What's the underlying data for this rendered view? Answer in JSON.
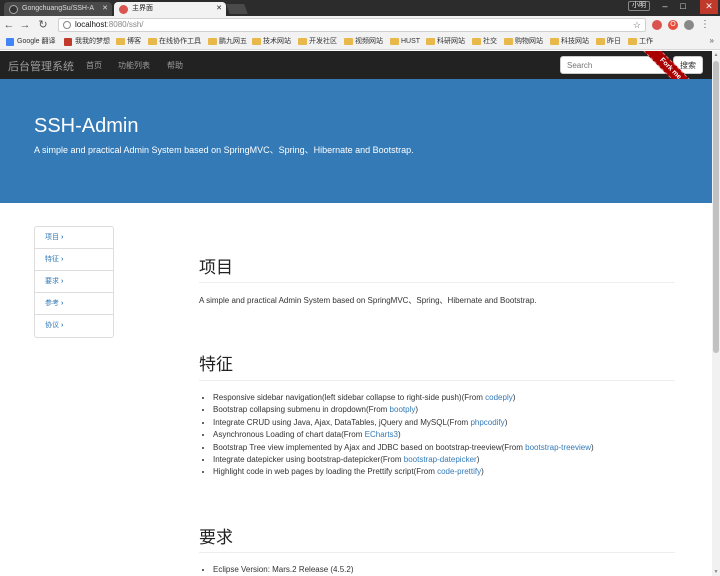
{
  "browser": {
    "tabs": [
      {
        "title": "GongchuangSu/SSH-A",
        "fav_color": "#333333"
      },
      {
        "title": "主界面",
        "fav_color": "#d9534f"
      }
    ],
    "window_user": "小明",
    "url_host": "localhost",
    "url_path": ":8080/ssh/",
    "bookmarks": [
      {
        "label": "Google 翻译",
        "type": "site",
        "color": "#4285f4"
      },
      {
        "label": "我我的梦想",
        "type": "site",
        "color": "#c0392b"
      },
      {
        "label": "博客",
        "type": "folder"
      },
      {
        "label": "在线协作工具",
        "type": "folder"
      },
      {
        "label": "鹏九网五",
        "type": "folder"
      },
      {
        "label": "技术网站",
        "type": "folder"
      },
      {
        "label": "开发社区",
        "type": "folder"
      },
      {
        "label": "视频网站",
        "type": "folder"
      },
      {
        "label": "HUST",
        "type": "folder"
      },
      {
        "label": "科研网站",
        "type": "folder"
      },
      {
        "label": "社交",
        "type": "folder"
      },
      {
        "label": "购物网站",
        "type": "folder"
      },
      {
        "label": "科技网站",
        "type": "folder"
      },
      {
        "label": "昨日",
        "type": "folder"
      },
      {
        "label": "工作",
        "type": "folder"
      }
    ]
  },
  "navbar": {
    "brand": "后台管理系统",
    "links": [
      "首页",
      "功能列表",
      "帮助"
    ],
    "search_placeholder": "Search",
    "search_button": "搜索",
    "ribbon": "Fork me on GitHub"
  },
  "jumbotron": {
    "title": "SSH-Admin",
    "subtitle": "A simple and practical Admin System based on SpringMVC、Spring、Hibernate and Bootstrap."
  },
  "sidebar": {
    "items": [
      "项目",
      "特征",
      "要求",
      "参考",
      "协议"
    ]
  },
  "sections": {
    "project": {
      "heading": "项目",
      "text": "A simple and practical Admin System based on SpringMVC、Spring、Hibernate and Bootstrap."
    },
    "features": {
      "heading": "特征",
      "items": [
        {
          "text": "Responsive sidebar navigation(left sidebar collapse to right-side push)(From ",
          "link": "codeply",
          "tail": ")"
        },
        {
          "text": "Bootstrap collapsing submenu in dropdown(From ",
          "link": "bootply",
          "tail": ")"
        },
        {
          "text": "Integrate CRUD using Java, Ajax, DataTables, jQuery and MySQL(From ",
          "link": "phpcodify",
          "tail": ")"
        },
        {
          "text": "Asynchronous Loading of chart data(From ",
          "link": "ECharts3",
          "tail": ")"
        },
        {
          "text": "Bootstrap Tree view implemented by Ajax and JDBC based on bootstrap-treeview(From ",
          "link": "bootstrap-treeview",
          "tail": ")"
        },
        {
          "text": "Integrate datepicker using bootstrap-datepicker(From ",
          "link": "bootstrap-datepicker",
          "tail": ")"
        },
        {
          "text": "Highlight code in web pages by loading the Prettify script(From ",
          "link": "code-prettify",
          "tail": ")"
        }
      ]
    },
    "requirements": {
      "heading": "要求",
      "items": [
        {
          "text": "Eclipse Version: Mars.2 Release (4.5.2)"
        }
      ]
    }
  }
}
